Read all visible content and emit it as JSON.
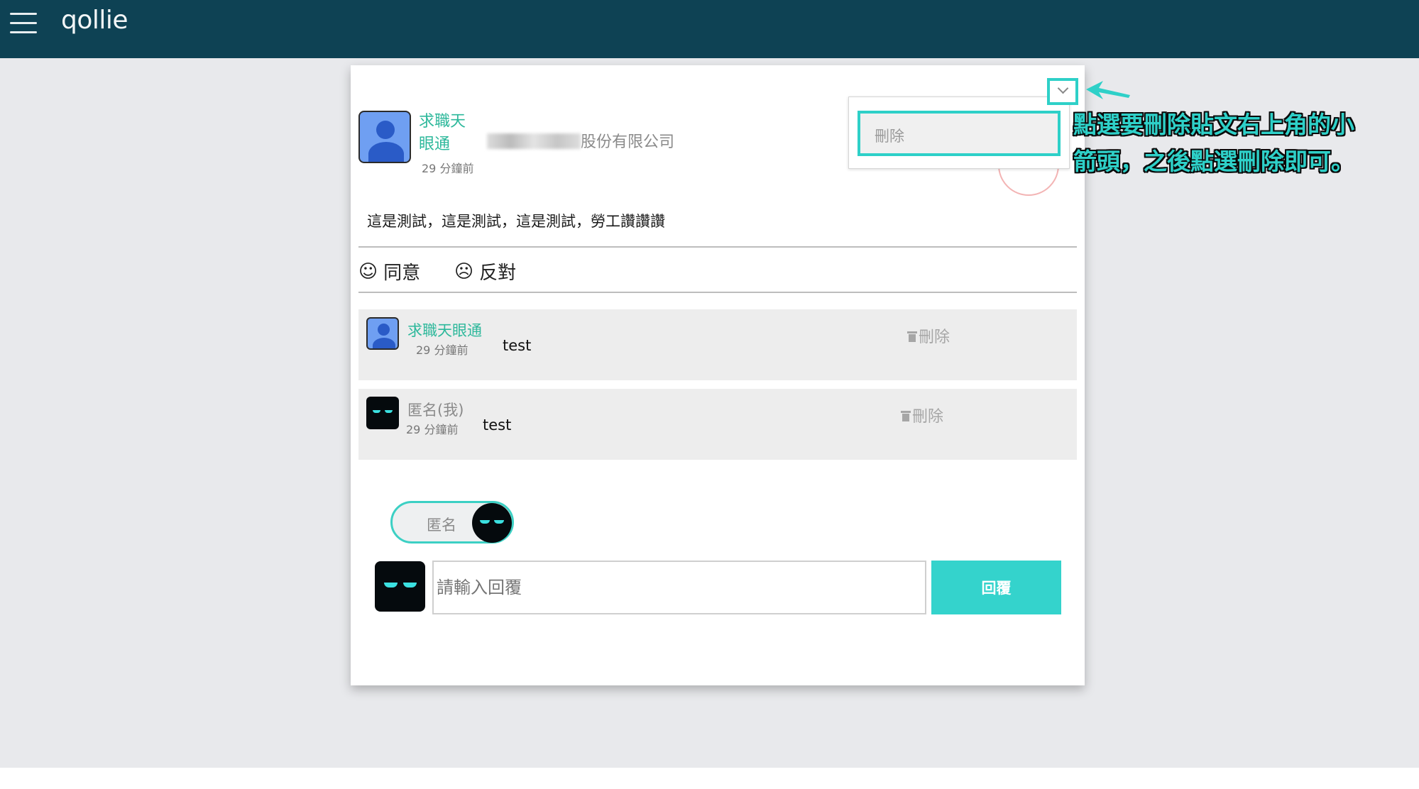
{
  "app": {
    "logo": "qollie"
  },
  "post": {
    "author": "求職天眼通",
    "author_line1": "求職天",
    "author_line2": "眼通",
    "time": "29 分鐘前",
    "company_suffix": "股份有限公司",
    "body": "這是測試，這是測試，這是測試，勞工讚讚讚",
    "menu": {
      "delete_label": "刪除"
    }
  },
  "reactions": {
    "agree": "同意",
    "disagree": "反對"
  },
  "comments": [
    {
      "name": "求職天眼通",
      "time": "29 分鐘前",
      "text": "test",
      "delete_label": "刪除"
    },
    {
      "name": "匿名(我)",
      "time": "29 分鐘前",
      "text": "test",
      "delete_label": "刪除"
    }
  ],
  "reply": {
    "anonymous_toggle_label": "匿名",
    "placeholder": "請輸入回覆",
    "submit_label": "回覆"
  },
  "annotation": {
    "line1": "點選要刪除貼文右上角的小",
    "line2": "箭頭，之後點選刪除即可。"
  },
  "colors": {
    "header": "#0e4254",
    "accent": "#2ed0c8",
    "author_green": "#2db89b"
  }
}
